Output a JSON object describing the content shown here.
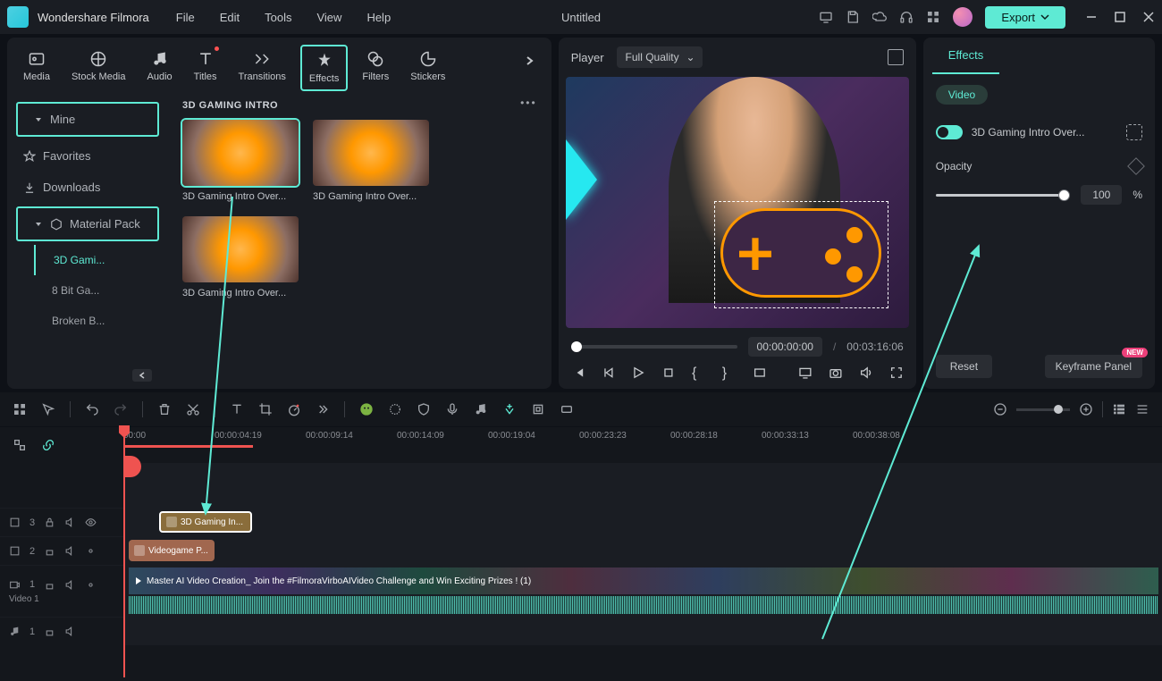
{
  "app": {
    "name": "Wondershare Filmora",
    "document": "Untitled",
    "export": "Export"
  },
  "menu": [
    "File",
    "Edit",
    "Tools",
    "View",
    "Help"
  ],
  "tabs": [
    {
      "label": "Media"
    },
    {
      "label": "Stock Media"
    },
    {
      "label": "Audio"
    },
    {
      "label": "Titles",
      "dot": true
    },
    {
      "label": "Transitions"
    },
    {
      "label": "Effects",
      "active": true
    },
    {
      "label": "Filters"
    },
    {
      "label": "Stickers"
    }
  ],
  "sidebar": {
    "mine": "Mine",
    "favorites": "Favorites",
    "downloads": "Downloads",
    "material_pack": "Material Pack",
    "subs": [
      "3D Gami...",
      "8 Bit Ga...",
      "Broken B..."
    ]
  },
  "gallery": {
    "title": "3D GAMING INTRO",
    "items": [
      "3D Gaming Intro Over...",
      "3D Gaming Intro Over...",
      "3D Gaming Intro Over..."
    ]
  },
  "player": {
    "label": "Player",
    "quality": "Full Quality",
    "current": "00:00:00:00",
    "sep": "/",
    "duration": "00:03:16:06"
  },
  "effects_panel": {
    "tab": "Effects",
    "pill": "Video",
    "effect_name": "3D Gaming Intro Over...",
    "opacity_label": "Opacity",
    "opacity_value": "100",
    "opacity_unit": "%",
    "reset": "Reset",
    "keyframe_panel": "Keyframe Panel",
    "new_badge": "NEW"
  },
  "timeline": {
    "ruler": [
      "00:00",
      "00:00:04:19",
      "00:00:09:14",
      "00:00:14:09",
      "00:00:19:04",
      "00:00:23:23",
      "00:00:28:18",
      "00:00:33:13",
      "00:00:38:08"
    ],
    "tracks": {
      "fx3": "3",
      "fx2": "2",
      "v1_num": "1",
      "v1_label": "Video 1",
      "a1": "1"
    },
    "clips": {
      "fx3": "3D Gaming In...",
      "fx2": "Videogame P...",
      "video": "Master AI Video Creation_ Join the #FilmoraVirboAIVideo Challenge and Win Exciting Prizes ! (1)"
    }
  }
}
